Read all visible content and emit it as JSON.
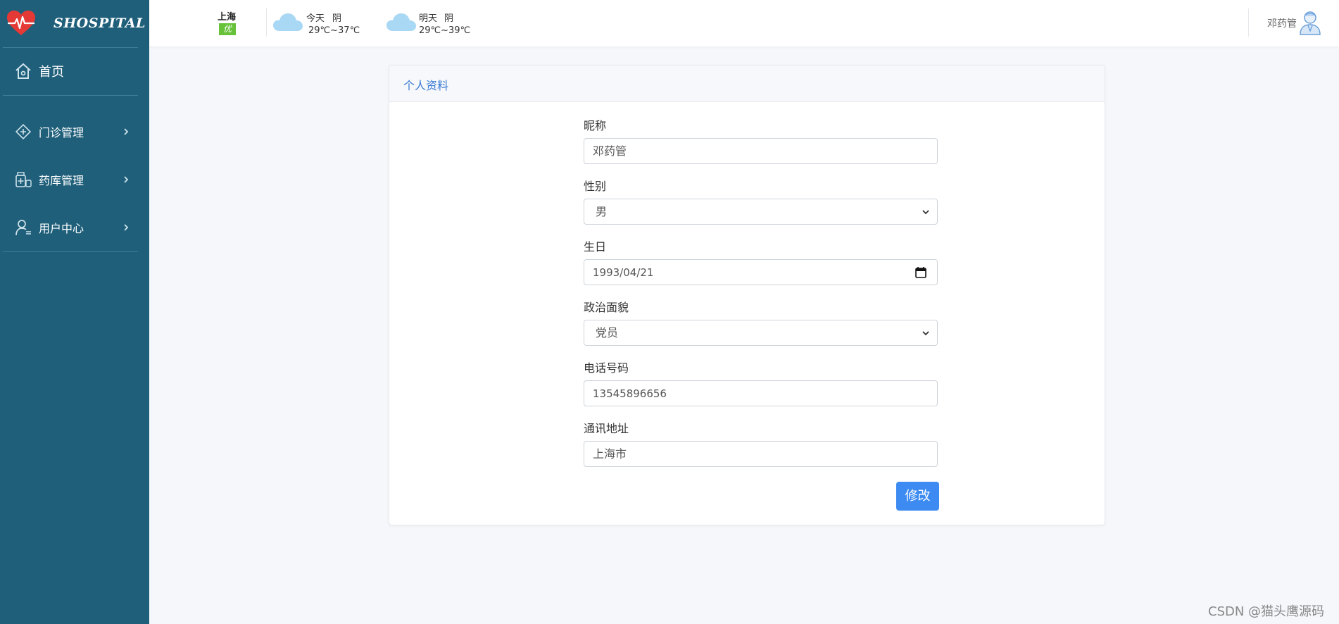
{
  "sidebar": {
    "brand": "SHOSPITAL",
    "items": [
      {
        "label": "首页",
        "icon": "home-icon"
      },
      {
        "label": "门诊管理",
        "icon": "clinic-icon"
      },
      {
        "label": "药库管理",
        "icon": "pharmacy-icon"
      },
      {
        "label": "用户中心",
        "icon": "user-center-icon"
      }
    ],
    "colors": {
      "background": "#1f5f7a"
    }
  },
  "topbar": {
    "city": "上海",
    "aqi": "优",
    "today": {
      "label": "今天",
      "weather": "阴",
      "temp": "29℃~37℃"
    },
    "tomorrow": {
      "label": "明天",
      "weather": "阴",
      "temp": "29℃~39℃"
    },
    "user_name": "邓药管"
  },
  "profile": {
    "title": "个人资料",
    "fields": [
      {
        "label": "昵称",
        "value": "邓药管",
        "type": "text"
      },
      {
        "label": "性别",
        "value": "男",
        "type": "select"
      },
      {
        "label": "生日",
        "value": "1993/04/21",
        "type": "date"
      },
      {
        "label": "政治面貌",
        "value": "党员",
        "type": "select"
      },
      {
        "label": "电话号码",
        "value": "13545896656",
        "type": "text"
      },
      {
        "label": "通讯地址",
        "value": "上海市",
        "type": "text"
      }
    ],
    "submit_label": "修改",
    "colors": {
      "title": "#3a7bd5",
      "button": "#3d8bf2"
    }
  },
  "watermark": "CSDN @猫头鹰源码"
}
